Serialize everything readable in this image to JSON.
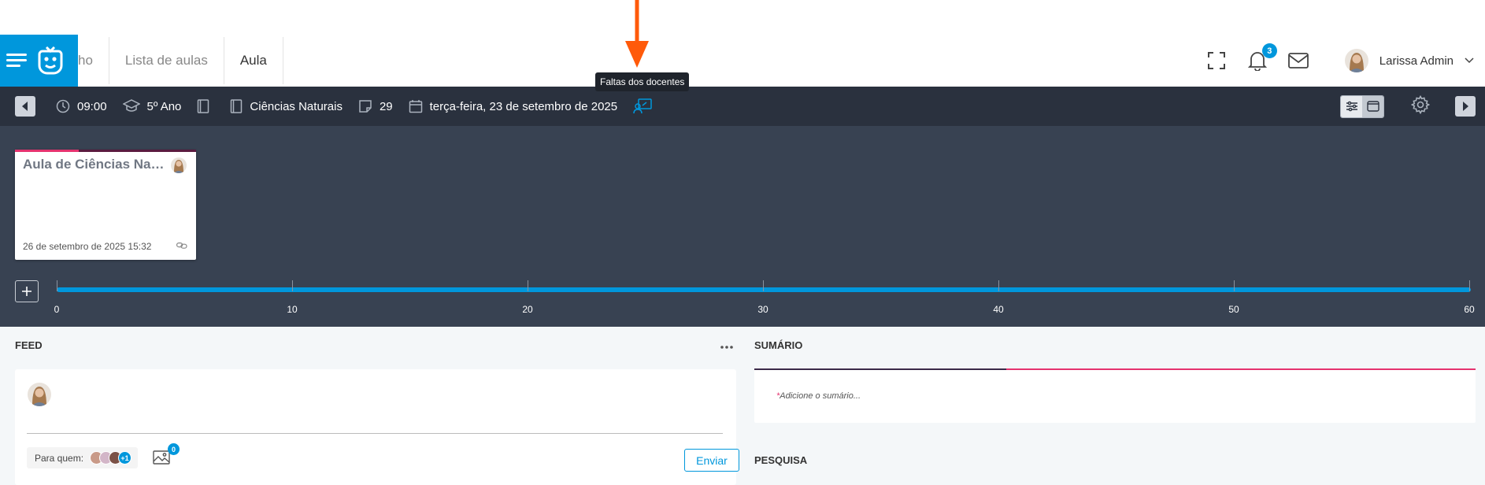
{
  "header": {
    "breadcrumbs": [
      "ho",
      "Lista de aulas",
      "Aula"
    ],
    "notifications_count": "3",
    "user_name": "Larissa Admin"
  },
  "tooltip": "Faltas dos docentes",
  "toolbar": {
    "time": "09:00",
    "grade": "5º Ano",
    "subject": "Ciências Naturais",
    "lesson_number": "29",
    "date": "terça-feira, 23 de setembro de 2025"
  },
  "lesson_card": {
    "title": "Aula de Ciências Naturais",
    "date": "26 de setembro de 2025 15:32"
  },
  "timeline": {
    "ticks": [
      "0",
      "10",
      "20",
      "30",
      "40",
      "50",
      "60"
    ]
  },
  "feed": {
    "title": "FEED",
    "para_quem_label": "Para quem:",
    "recipients_extra": "+1",
    "attachments_count": "0",
    "send_label": "Enviar"
  },
  "summary": {
    "title": "SUMÁRIO",
    "placeholder_required": "*",
    "placeholder": "Adicione o sumário..."
  },
  "research": {
    "title": "PESQUISA"
  },
  "colors": {
    "brand": "#0097dc",
    "toolbar_bg": "#2a313e",
    "timeline_bg": "#384252",
    "accent_pink": "#e5336f",
    "annotation_arrow": "#ff5a0a"
  }
}
